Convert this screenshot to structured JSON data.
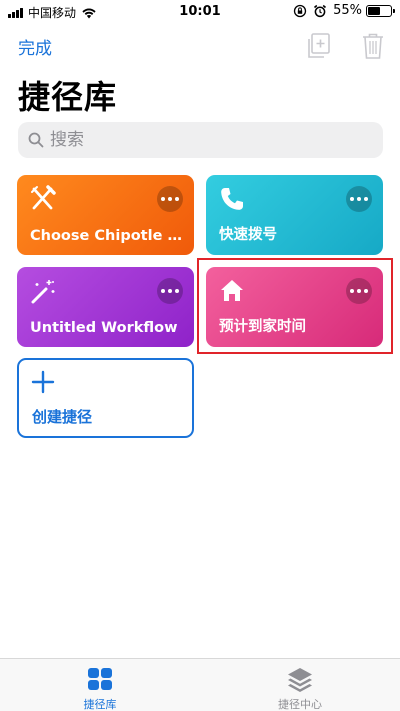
{
  "status_bar": {
    "carrier": "中国移动",
    "time": "10:01",
    "battery_percent": "55%",
    "battery_level": 0.55
  },
  "nav": {
    "done_label": "完成"
  },
  "page_title": "捷径库",
  "search": {
    "placeholder": "搜索"
  },
  "shortcuts": [
    {
      "label": "Choose Chipotle O...",
      "icon": "fork-knife-icon",
      "color": "#f47114"
    },
    {
      "label": "快速拨号",
      "icon": "phone-icon",
      "color": "#22bcd4"
    },
    {
      "label": "Untitled Workflow",
      "icon": "magic-wand-icon",
      "color": "#a538d6"
    },
    {
      "label": "预计到家时间",
      "icon": "home-icon",
      "color": "#e6418a"
    }
  ],
  "create_shortcut": {
    "label": "创建捷径"
  },
  "tab_bar": {
    "tabs": [
      {
        "label": "捷径库",
        "icon": "grid-icon",
        "active": true
      },
      {
        "label": "捷径中心",
        "icon": "layers-icon",
        "active": false
      }
    ]
  },
  "colors": {
    "accent": "#1a73d9",
    "highlight": "#e0242a"
  }
}
